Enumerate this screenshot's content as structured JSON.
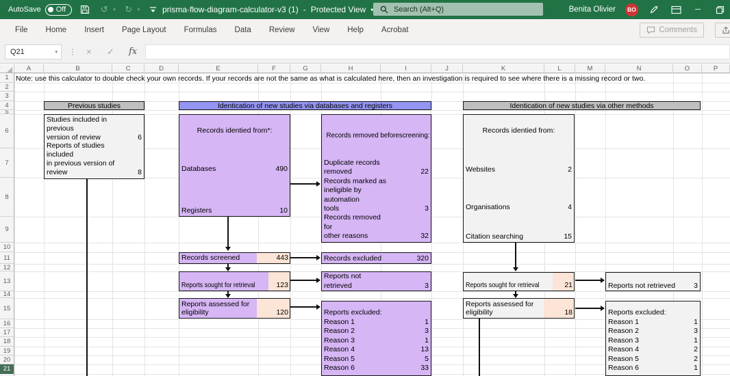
{
  "titlebar": {
    "autosave_label": "AutoSave",
    "autosave_state": "Off",
    "filename": "prisma-flow-diagram-calculator-v3 (1)",
    "separator": "-",
    "mode": "Protected View",
    "search_placeholder": "Search (Alt+Q)",
    "user_name": "Benita Olivier",
    "user_initials": "BO"
  },
  "icons": {
    "undo": "↺",
    "redo": "↻",
    "minimize": "─",
    "dots": "⋮",
    "cancel": "×",
    "enter": "✓",
    "fx": "fx",
    "caret": "▾"
  },
  "ribbon": {
    "tabs": [
      "File",
      "Home",
      "Insert",
      "Page Layout",
      "Formulas",
      "Data",
      "Review",
      "View",
      "Help",
      "Acrobat"
    ],
    "comments_label": "Comments",
    "share_label": "Share"
  },
  "formula_bar": {
    "name_box": "Q21",
    "formula_value": ""
  },
  "sheet": {
    "columns": [
      "A",
      "B",
      "C",
      "D",
      "E",
      "F",
      "G",
      "H",
      "I",
      "J",
      "K",
      "L",
      "M",
      "N",
      "O",
      "P"
    ],
    "rows": [
      "1",
      "2",
      "3",
      "4",
      "5",
      "6",
      "7",
      "8",
      "9",
      "10",
      "11",
      "12",
      "13",
      "14",
      "15",
      "16",
      "17",
      "18",
      "19",
      "20",
      "21"
    ],
    "active_row": "21",
    "note": "Note: use this calculator to double check your own records. If your records are not the same as what is calculated here, then an investigation is required to see where there is a missing record or two."
  },
  "diagram": {
    "headers": {
      "previous": "Previous studies",
      "databases": "Identication of new studies via databases and registers",
      "other": "Identication of new studies via other methods"
    },
    "previous_box": {
      "lines": [
        {
          "t": "Studies included in",
          "v": ""
        },
        {
          "t": "previous",
          "v": ""
        },
        {
          "t": "version of review",
          "v": "6"
        },
        {
          "t": "Reports of studies",
          "v": ""
        },
        {
          "t": "included",
          "v": ""
        },
        {
          "t": "in previous version of",
          "v": ""
        },
        {
          "t": "review",
          "v": "8"
        }
      ]
    },
    "records_identified": {
      "title": "Records identied from*:",
      "databases_label": "Databases",
      "databases_value": "490",
      "registers_label": "Registers",
      "registers_value": "10"
    },
    "records_removed": {
      "title": "Records removed beforescreening:",
      "lines": [
        {
          "t": "Duplicate records",
          "v": ""
        },
        {
          "t": "removed",
          "v": "22"
        },
        {
          "t": "Records marked as",
          "v": ""
        },
        {
          "t": "ineligible by",
          "v": ""
        },
        {
          "t": "automation",
          "v": ""
        },
        {
          "t": "tools",
          "v": "3"
        },
        {
          "t": "Records removed",
          "v": ""
        },
        {
          "t": "for",
          "v": ""
        },
        {
          "t": "other reasons",
          "v": "32"
        }
      ]
    },
    "records_identified_other": {
      "title": "Records identied from:",
      "websites_label": "Websites",
      "websites_value": "2",
      "organisations_label": "Organisations",
      "organisations_value": "4",
      "citation_label": "Citation searching",
      "citation_value": "15"
    },
    "records_screened": {
      "label": "Records screened",
      "value": "443"
    },
    "records_excluded": {
      "label": "Records excluded",
      "value": "320"
    },
    "reports_sought": {
      "label": "Reports sought for retrieval",
      "value": "123"
    },
    "reports_not_retrieved": {
      "line1": "Reports not",
      "line2": "retrieved",
      "value": "3"
    },
    "reports_assessed": {
      "line1": "Reports assessed for",
      "line2": "eligibility",
      "value": "120"
    },
    "reports_excluded": {
      "title": "Reports excluded:",
      "reasons": [
        {
          "t": "Reason 1",
          "v": "1"
        },
        {
          "t": "Reason 2",
          "v": "3"
        },
        {
          "t": "Reason 3",
          "v": "1"
        },
        {
          "t": "Reason 4",
          "v": "13"
        },
        {
          "t": "Reason 5",
          "v": "5"
        },
        {
          "t": "Reason 6",
          "v": "33"
        }
      ]
    },
    "reports_sought_right": {
      "label": "Reports sought for retrieval",
      "value": "21"
    },
    "reports_not_retrieved_right": {
      "label": "Reports not retrieved",
      "value": "3"
    },
    "reports_assessed_right": {
      "line1": "Reports assessed for",
      "line2": "eligibility",
      "value": "18"
    },
    "reports_excluded_right": {
      "title": "Reports excluded:",
      "reasons": [
        {
          "t": "Reason 1",
          "v": "1"
        },
        {
          "t": "Reason 2",
          "v": "3"
        },
        {
          "t": "Reason 3",
          "v": "1"
        },
        {
          "t": "Reason 4",
          "v": "2"
        },
        {
          "t": "Reason 5",
          "v": "2"
        },
        {
          "t": "Reason 6",
          "v": "1"
        }
      ]
    }
  },
  "colors": {
    "titlebar_green": "#217346",
    "purple_header": "#9494f2",
    "purple_box": "#d6b6f5",
    "peach": "#fce4d6",
    "gray_header": "#bfbfbf",
    "gray_box": "#f2f2f2",
    "avatar_red": "#d13438",
    "search_fill": "#a3c1b0"
  }
}
